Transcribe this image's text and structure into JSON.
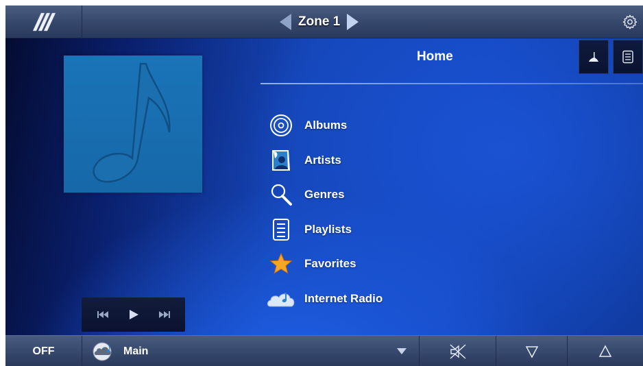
{
  "top_bar": {
    "zone": "Zone 1",
    "icons": {
      "logo": "logo-icon",
      "prev_zone": "triangle-left-icon",
      "next_zone": "triangle-right-icon",
      "settings": "gear-icon"
    }
  },
  "now_playing": {
    "album_art_icon": "music-note-icon",
    "transport": [
      "previous-icon",
      "play-icon",
      "next-icon"
    ]
  },
  "browser": {
    "title": "Home",
    "header_buttons": [
      "now-playing-icon",
      "queue-list-icon"
    ],
    "items": [
      {
        "label": "Albums",
        "icon": "disc-icon"
      },
      {
        "label": "Artists",
        "icon": "artist-icon"
      },
      {
        "label": "Genres",
        "icon": "magnifier-icon"
      },
      {
        "label": "Playlists",
        "icon": "playlist-icon"
      },
      {
        "label": "Favorites",
        "icon": "star-icon"
      },
      {
        "label": "Internet Radio",
        "icon": "cloud-icon"
      }
    ]
  },
  "bottom_bar": {
    "power": "OFF",
    "source": "Main",
    "source_icon": "source-cloud-icon",
    "controls": [
      "mute-icon",
      "volume-down-icon",
      "volume-up-icon"
    ]
  },
  "colors": {
    "accent_star": "#f5a623",
    "background_blue": "#1546b8",
    "bar": "#3a4a6e"
  }
}
